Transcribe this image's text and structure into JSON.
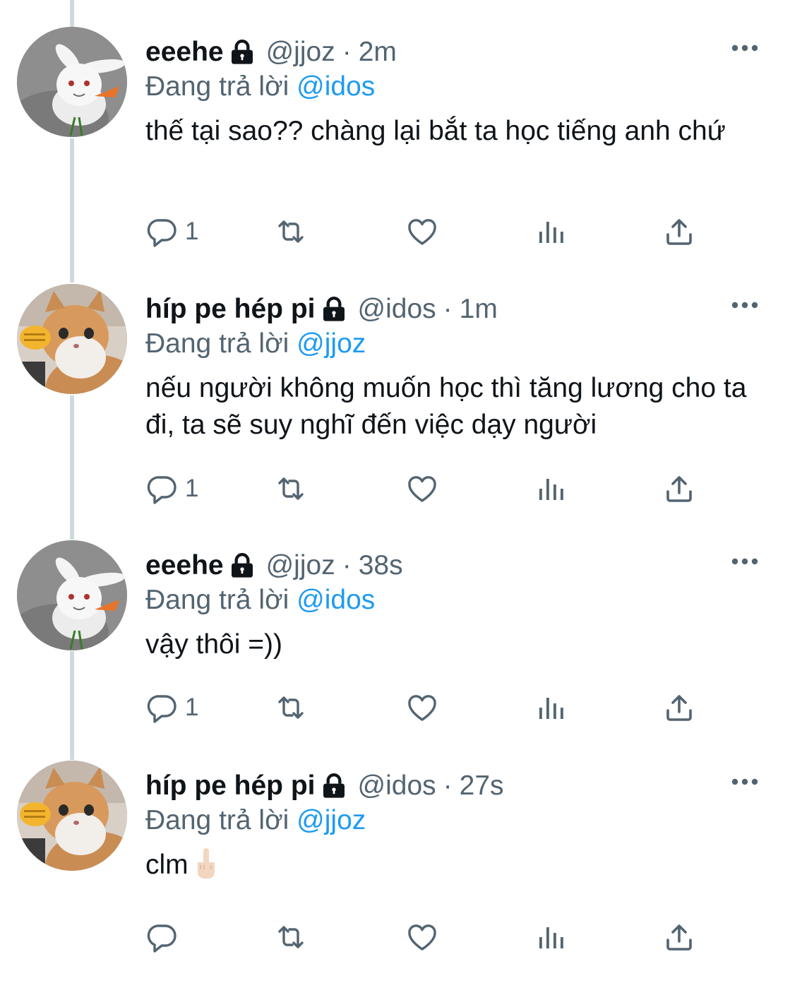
{
  "colors": {
    "name": "#0f1419",
    "secondary": "#536471",
    "accent": "#1d9bf0",
    "thread_line": "#cfd9de"
  },
  "tweets": [
    {
      "display_name": "eeehe",
      "handle": "@jjoz",
      "separator": "·",
      "time": "2m",
      "reply_prefix": "Đang trả lời",
      "reply_to": "@idos",
      "text": "thế tại sao?? chàng lại bắt ta học tiếng anh chứ",
      "reply_count": "1",
      "avatar": "rabbit-avatar"
    },
    {
      "display_name": "híp pe hép pi",
      "handle": "@idos",
      "separator": "·",
      "time": "1m",
      "reply_prefix": "Đang trả lời",
      "reply_to": "@jjoz",
      "text": "nếu người không muốn học thì tăng lương cho ta đi, ta sẽ suy nghĩ đến việc dạy người",
      "reply_count": "1",
      "avatar": "cat-avatar"
    },
    {
      "display_name": "eeehe",
      "handle": "@jjoz",
      "separator": "·",
      "time": "38s",
      "reply_prefix": "Đang trả lời",
      "reply_to": "@idos",
      "text": "vậy thôi =))",
      "reply_count": "1",
      "avatar": "rabbit-avatar"
    },
    {
      "display_name": "híp pe hép pi",
      "handle": "@idos",
      "separator": "·",
      "time": "27s",
      "reply_prefix": "Đang trả lời",
      "reply_to": "@jjoz",
      "text": "clm",
      "emoji": "middle-finger-emoji",
      "reply_count": "",
      "avatar": "cat-avatar"
    }
  ],
  "icons": {
    "lock": "lock-icon",
    "more": "more-icon",
    "reply": "reply-icon",
    "retweet": "retweet-icon",
    "like": "heart-icon",
    "views": "views-icon",
    "share": "share-icon"
  }
}
